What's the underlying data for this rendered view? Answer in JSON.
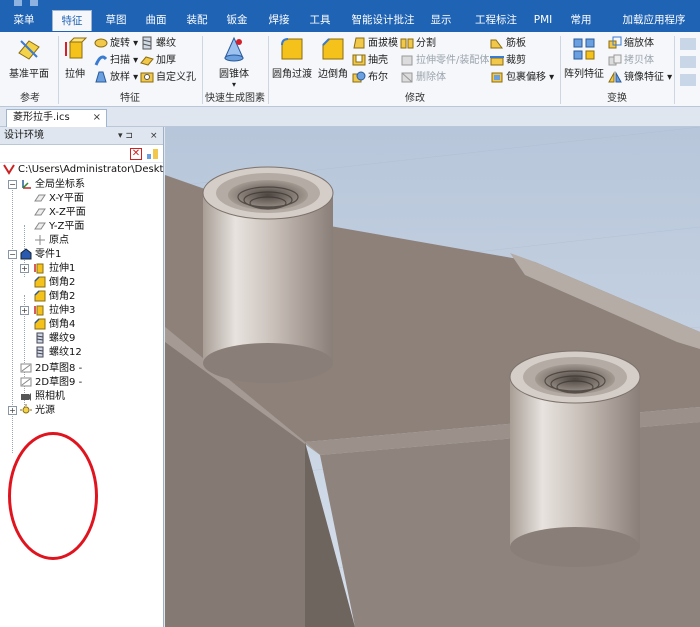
{
  "tabs": [
    {
      "label": "菜单",
      "active": false
    },
    {
      "label": "特征",
      "active": true
    },
    {
      "label": "草图",
      "active": false
    },
    {
      "label": "曲面",
      "active": false
    },
    {
      "label": "装配",
      "active": false
    },
    {
      "label": "钣金",
      "active": false
    },
    {
      "label": "焊接",
      "active": false
    },
    {
      "label": "工具",
      "active": false
    },
    {
      "label": "智能设计批注",
      "active": false
    },
    {
      "label": "显示",
      "active": false
    },
    {
      "label": "工程标注",
      "active": false
    },
    {
      "label": "PMI",
      "active": false
    },
    {
      "label": "常用",
      "active": false
    },
    {
      "label": "加载应用程序",
      "active": false
    }
  ],
  "ribbon": {
    "groups": {
      "reference": "参考",
      "feature": "特征",
      "quick": "快速生成图素",
      "modify": "修改",
      "transform": "变换"
    },
    "base_plane": "基准平面",
    "extrude": "拉伸",
    "revolve": "旋转",
    "sweep": "扫描",
    "loft": "放样",
    "thread": "螺纹",
    "thicken": "加厚",
    "custom_hole": "自定义孔",
    "cone": "圆锥体",
    "fillet": "圆角过渡",
    "chamfer": "边倒角",
    "draft": "面拔模",
    "shell": "抽壳",
    "boolean": "布尔",
    "split": "分割",
    "extrude_part": "拉伸零件/装配体",
    "delete_body": "删除体",
    "rib": "筋板",
    "trim": "裁剪",
    "wrap_offset": "包裹偏移",
    "pattern": "阵列特征",
    "scale": "缩放体",
    "copy": "拷贝体",
    "mirror": "镜像特征"
  },
  "document_tab": {
    "name": "菱形拉手.ics",
    "close": "×"
  },
  "panel": {
    "title": "设计环境",
    "pin": "▾ ⊐",
    "close": "×",
    "tree": {
      "root": "C:\\Users\\Administrator\\Deskt",
      "coords": "全局坐标系",
      "xy": "X-Y平面",
      "xz": "X-Z平面",
      "yz": "Y-Z平面",
      "origin": "原点",
      "part": "零件1",
      "f1": "拉伸1",
      "f2": "倒角2",
      "f3": "倒角2",
      "f4": "拉伸3",
      "f5": "倒角4",
      "f6": "螺纹9",
      "f7": "螺纹12",
      "sk1": "2D草图8 -",
      "sk2": "2D草图9 -",
      "camera": "照相机",
      "light": "光源"
    }
  },
  "colors": {
    "ribbon_blue": "#1f63b4",
    "annotation_red": "#e0141e",
    "viewport_bg": "#c7d3e3"
  }
}
